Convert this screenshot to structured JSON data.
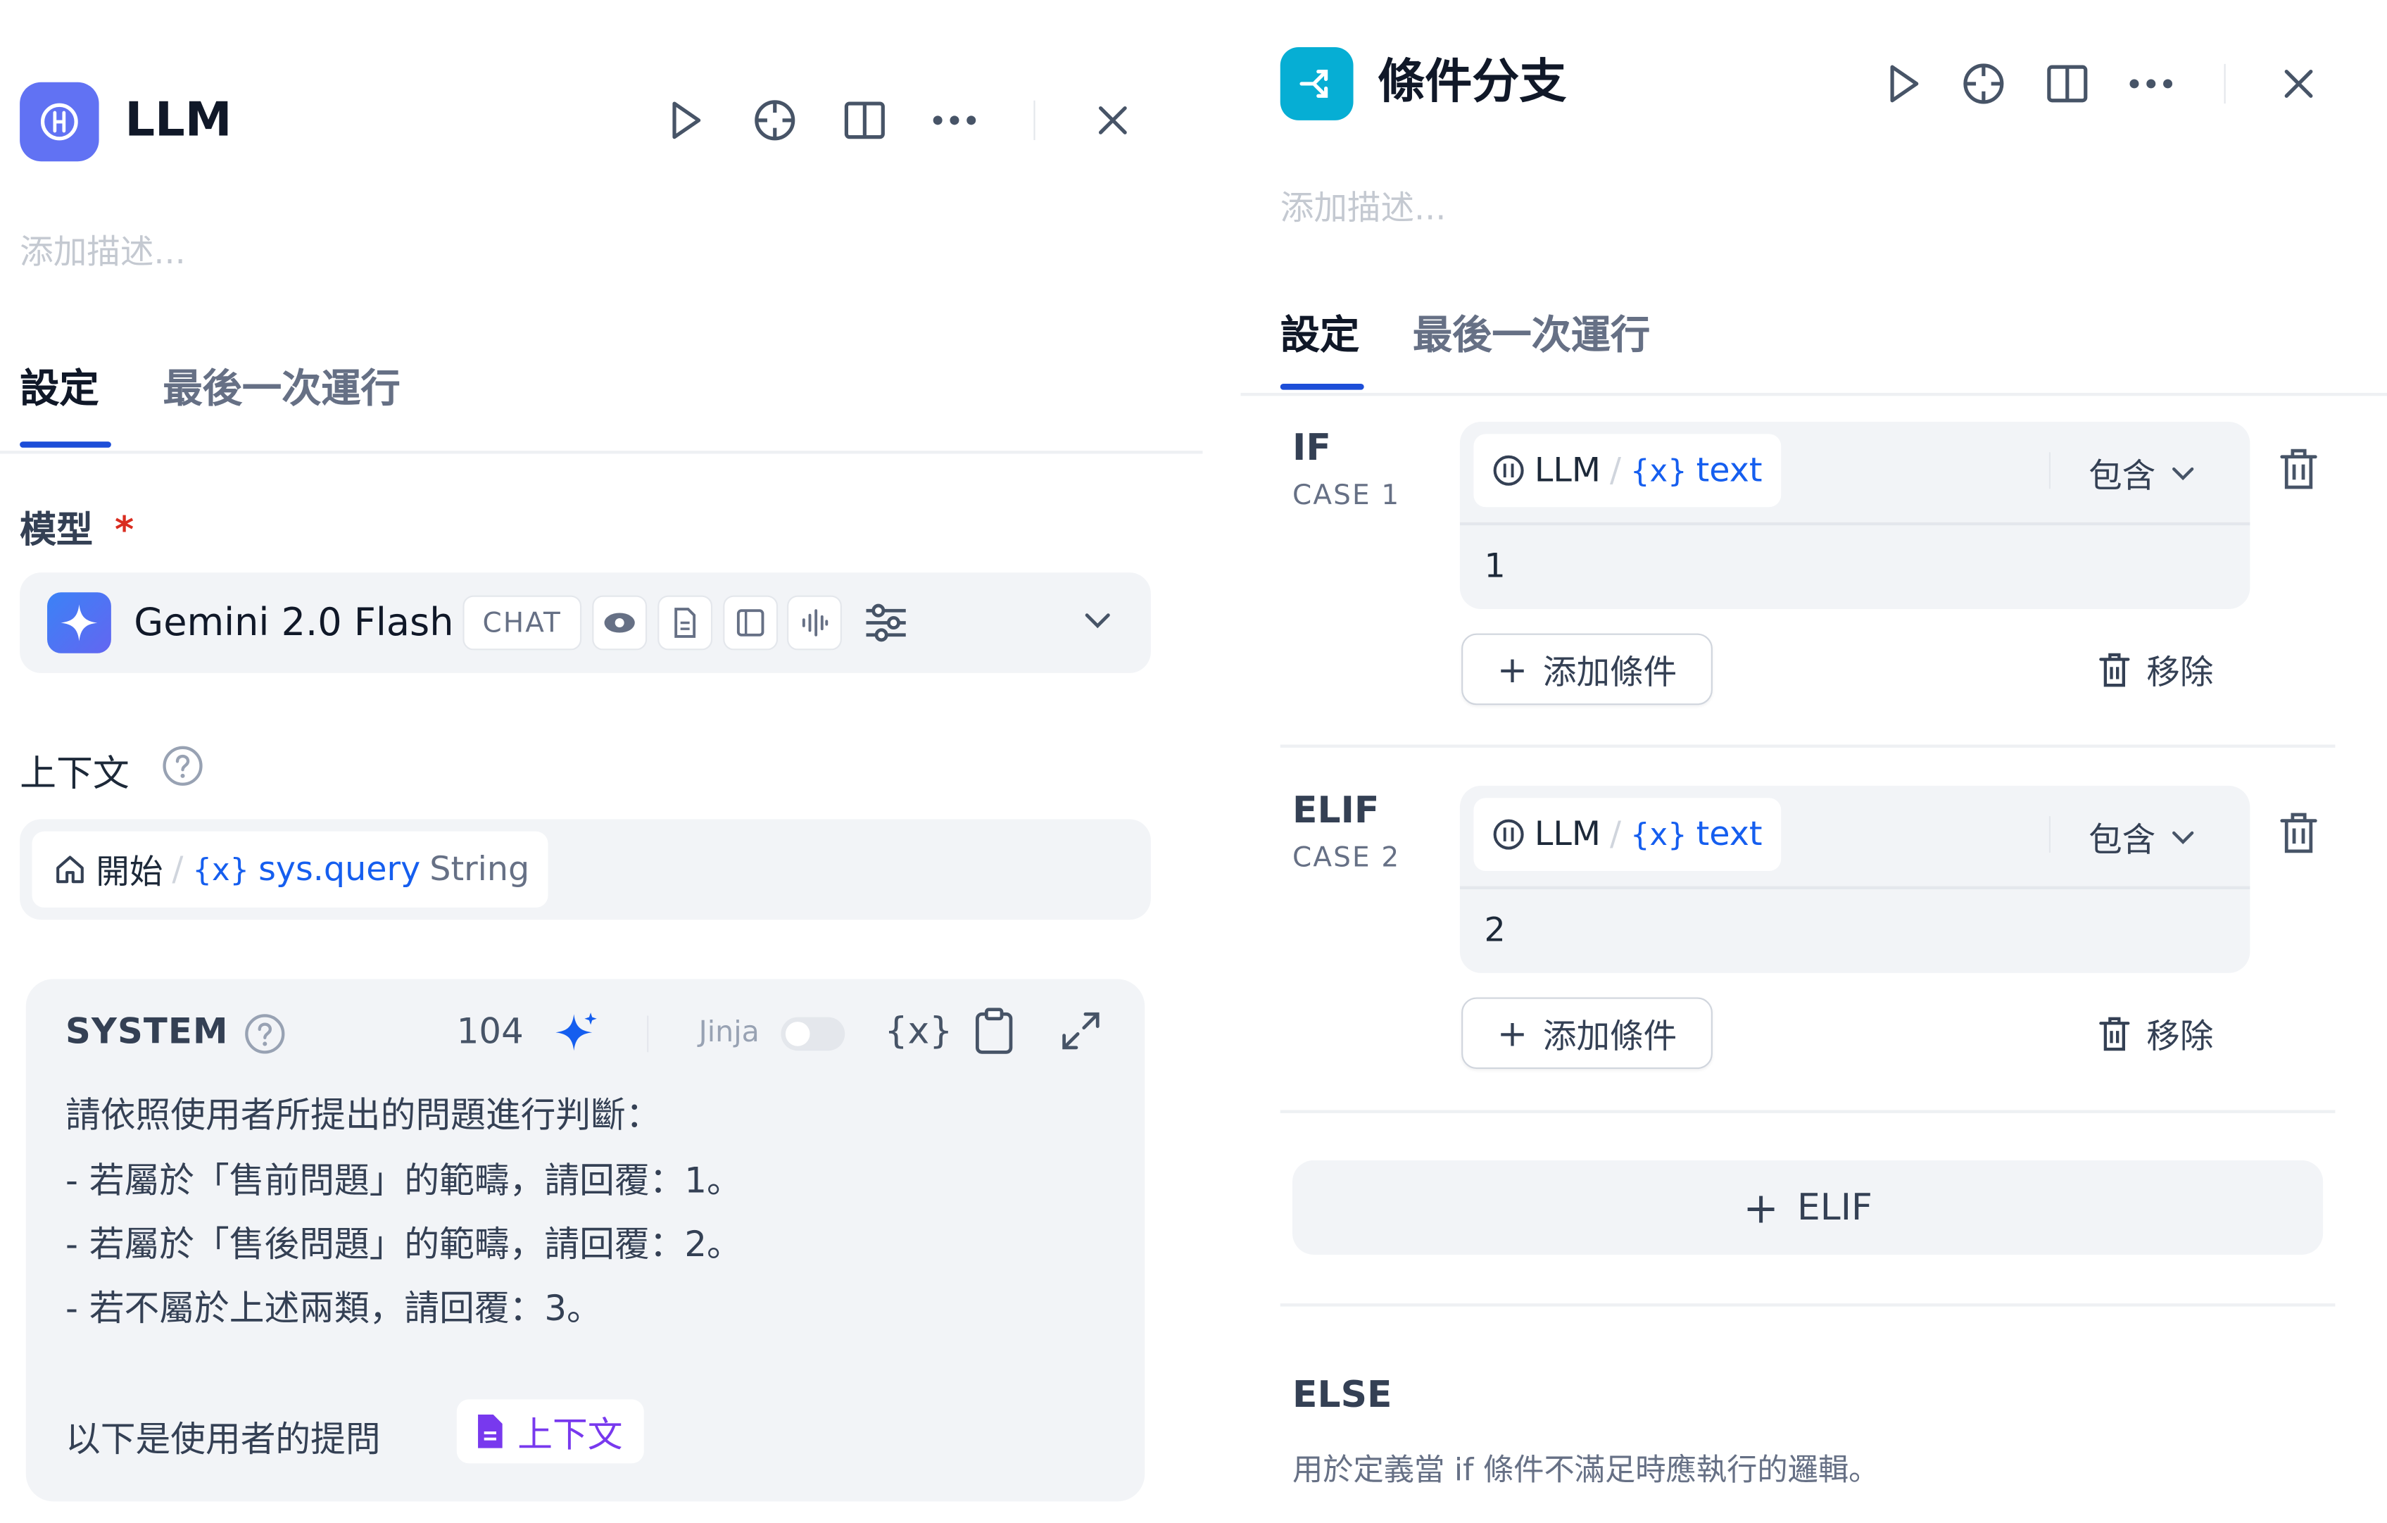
{
  "llm_panel": {
    "title": "LLM",
    "description_placeholder": "添加描述...",
    "tabs": [
      {
        "label": "設定",
        "active": true
      },
      {
        "label": "最後一次運行",
        "active": false
      }
    ],
    "model": {
      "label": "模型",
      "required_mark": "*",
      "name": "Gemini 2.0 Flash",
      "mode_badge": "CHAT"
    },
    "context": {
      "label": "上下文",
      "source_node": "開始",
      "variable": "sys.query",
      "type": "String"
    },
    "system_prompt": {
      "label": "SYSTEM",
      "token_count": "104",
      "jinja_label": "Jinja",
      "var_button": "{x}",
      "lines": [
        "請依照使用者所提出的問題進行判斷：",
        "- 若屬於「售前問題」的範疇，請回覆：1。",
        "- 若屬於「售後問題」的範疇，請回覆：2。",
        "- 若不屬於上述兩類，請回覆：3。",
        "以下是使用者的提問"
      ],
      "context_chip": "上下文"
    }
  },
  "branch_panel": {
    "title": "條件分支",
    "description_placeholder": "添加描述...",
    "tabs": [
      {
        "label": "設定",
        "active": true
      },
      {
        "label": "最後一次運行",
        "active": false
      }
    ],
    "cases": [
      {
        "keyword": "IF",
        "case_label": "CASE 1",
        "node": "LLM",
        "variable": "text",
        "operator": "包含",
        "value": "1",
        "add_condition": "添加條件",
        "remove": "移除"
      },
      {
        "keyword": "ELIF",
        "case_label": "CASE 2",
        "node": "LLM",
        "variable": "text",
        "operator": "包含",
        "value": "2",
        "add_condition": "添加條件",
        "remove": "移除"
      }
    ],
    "add_elif": "ELIF",
    "else": {
      "label": "ELSE",
      "description": "用於定義當 if 條件不滿足時應執行的邏輯。"
    }
  },
  "colors": {
    "accent_blue": "#155eef",
    "llm_icon": "#6172f3",
    "branch_icon": "#06aed4",
    "context_purple": "#7839ee"
  }
}
